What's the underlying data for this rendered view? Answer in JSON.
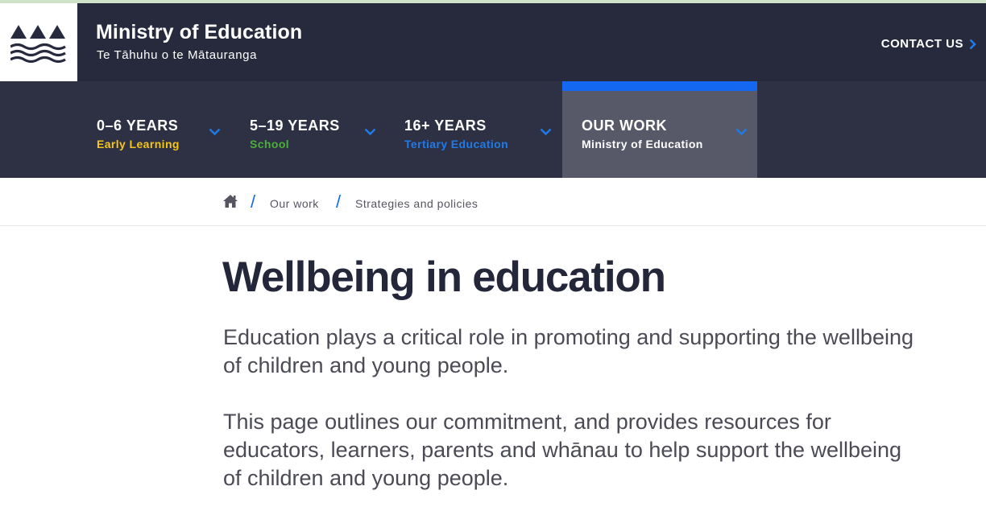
{
  "header": {
    "title": "Ministry of Education",
    "subtitle": "Te Tāhuhu o te Mātauranga",
    "contact_label": "CONTACT US"
  },
  "nav": {
    "items": [
      {
        "title": "0–6 YEARS",
        "subtitle": "Early Learning",
        "subtitle_color": "#f5c518"
      },
      {
        "title": "5–19 YEARS",
        "subtitle": "School",
        "subtitle_color": "#4caf3c"
      },
      {
        "title": "16+ YEARS",
        "subtitle": "Tertiary Education",
        "subtitle_color": "#1f7be8"
      },
      {
        "title": "OUR WORK",
        "subtitle": "Ministry of Education",
        "subtitle_color": "#ffffff",
        "active": true
      }
    ]
  },
  "breadcrumb": {
    "items": [
      "Our work",
      "Strategies and policies"
    ]
  },
  "main": {
    "title": "Wellbeing in education",
    "paragraphs": [
      "Education plays a critical role in promoting and supporting the wellbeing of children and young people.",
      "This page outlines our commitment, and provides resources for educators, learners, parents and whānau to help support the wellbeing of children and young people."
    ]
  },
  "colors": {
    "header_bg": "#272a3d",
    "nav_bg": "#2e3044",
    "accent": "#1467f0"
  }
}
